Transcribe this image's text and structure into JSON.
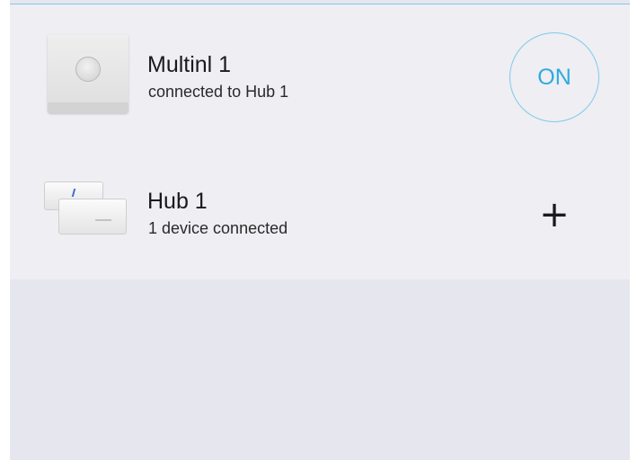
{
  "devices": [
    {
      "name": "Multinl 1",
      "status": "connected to Hub 1",
      "thumbnail_icon": "multinl-device-icon",
      "action_label": "ON",
      "action_color": "#2eaadf"
    },
    {
      "name": "Hub 1",
      "status": "1 device connected",
      "thumbnail_icon": "hub-device-icon",
      "action_label": "+"
    }
  ],
  "colors": {
    "accent": "#2eaadf",
    "list_background": "#eeeef3",
    "page_background": "#e6e7ee"
  }
}
